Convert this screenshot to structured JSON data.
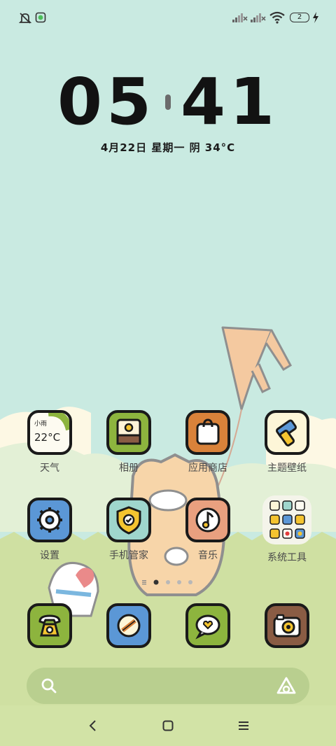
{
  "status_bar": {
    "left_icons": [
      "bell-off-icon",
      "app-notification-icon"
    ],
    "right_icons": [
      "signal-1-icon",
      "signal-2-icon",
      "wifi-icon"
    ],
    "battery": "2",
    "charging_icon": "bolt-icon"
  },
  "clock": {
    "hours": "05",
    "minutes": "41",
    "date": "4月22日  星期一  阴  34°C"
  },
  "apps_row1": [
    {
      "label": "天气",
      "icon": "weather-icon",
      "widget_text_1": "小雨",
      "widget_text_2": "22°C"
    },
    {
      "label": "相册",
      "icon": "gallery-icon"
    },
    {
      "label": "应用商店",
      "icon": "app-store-icon"
    },
    {
      "label": "主题壁纸",
      "icon": "themes-icon"
    }
  ],
  "apps_row2": [
    {
      "label": "设置",
      "icon": "settings-icon"
    },
    {
      "label": "手机管家",
      "icon": "security-icon"
    },
    {
      "label": "音乐",
      "icon": "music-icon"
    },
    {
      "label": "系统工具",
      "icon": "folder-icon"
    }
  ],
  "dock": [
    {
      "icon": "phone-icon"
    },
    {
      "icon": "browser-icon"
    },
    {
      "icon": "messages-icon"
    },
    {
      "icon": "camera-icon"
    }
  ],
  "page_indicator": {
    "total": 4,
    "current": 1
  },
  "search_bar": {
    "search_icon": "search-icon",
    "assistant_icon": "assistant-icon"
  },
  "nav_bar": [
    "back-icon",
    "home-icon",
    "menu-icon"
  ],
  "colors": {
    "sky": "#c9eae1",
    "grass": "#cfe0a2",
    "outline": "#1a1a1a",
    "green_icon": "#8db43e",
    "orange_icon": "#d9823a",
    "blue_icon": "#5b97d6",
    "teal_icon": "#9fd6cd",
    "salmon_icon": "#e9a07f",
    "brown_icon": "#8a5c44"
  }
}
